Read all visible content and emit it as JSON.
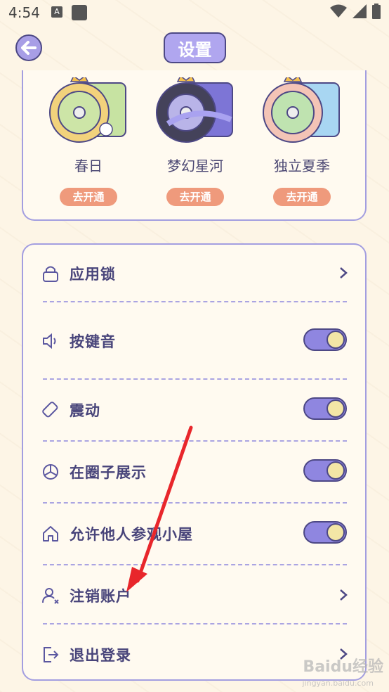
{
  "status_bar": {
    "time": "4:54",
    "notif_badge": "A"
  },
  "header": {
    "title": "设置"
  },
  "themes": [
    {
      "name": "春日",
      "button": "去开通",
      "accent": "#a9d27a"
    },
    {
      "name": "梦幻星河",
      "button": "去开通",
      "accent": "#7d75d6"
    },
    {
      "name": "独立夏季",
      "button": "去开通",
      "accent": "#8fc7ef"
    }
  ],
  "settings": [
    {
      "label": "应用锁",
      "control": "chevron",
      "icon": "lock-icon"
    },
    {
      "label": "按键音",
      "control": "toggle",
      "on": true,
      "icon": "speaker-icon"
    },
    {
      "label": "震动",
      "control": "toggle",
      "on": true,
      "icon": "vibrate-icon"
    },
    {
      "label": "在圈子展示",
      "control": "toggle",
      "on": true,
      "icon": "circle-icon"
    },
    {
      "label": "允许他人参观小屋",
      "control": "toggle",
      "on": true,
      "icon": "house-icon"
    },
    {
      "label": "注销账户",
      "control": "chevron",
      "icon": "user-remove-icon"
    },
    {
      "label": "退出登录",
      "control": "chevron",
      "icon": "logout-icon"
    }
  ],
  "watermark": {
    "text": "Baidu经验",
    "sub": "jingyan.baidu.com"
  },
  "colors": {
    "accent": "#8f86e0",
    "button": "#ef9a7c",
    "background": "#fdf5e6"
  }
}
